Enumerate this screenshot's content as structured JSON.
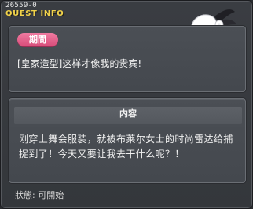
{
  "window": {
    "quest_id": "26559-0",
    "title": "QUEST INFO"
  },
  "period": {
    "badge_label": "期間",
    "text": "[皇家造型]这样才像我的贵宾!"
  },
  "content": {
    "header": "内容",
    "text": "刚穿上舞会服装，就被布莱尔女士的时尚雷达给捕捉到了！今天又要让我去干什么呢？！"
  },
  "status": {
    "text": "狀態: 可開始"
  },
  "npc": {
    "icon": "npc-lady-with-hat-icon"
  },
  "colors": {
    "title": "#f1d24a",
    "badge": "#e0608a",
    "background": "#3a3d42"
  }
}
